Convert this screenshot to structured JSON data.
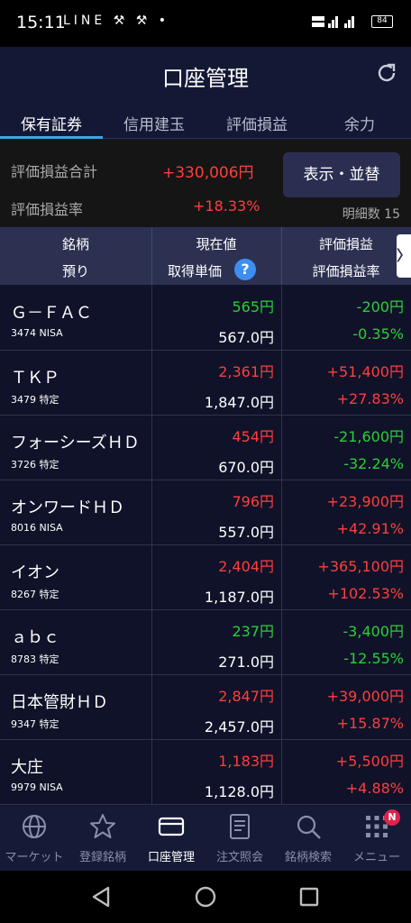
{
  "status_bar": {
    "time": "15:11",
    "left_icons": "LINE ⚒ ⚒ •",
    "battery": "84"
  },
  "header": {
    "title": "口座管理"
  },
  "tabs": [
    {
      "label": "保有証券"
    },
    {
      "label": "信用建玉"
    },
    {
      "label": "評価損益"
    },
    {
      "label": "余力"
    }
  ],
  "summary": {
    "total_label": "評価損益合計",
    "total_value": "+330,006円",
    "rate_label": "評価損益率",
    "rate_value": "+18.33%",
    "display_button": "表示・並替",
    "count": "明細数 15"
  },
  "table_header": {
    "col1_line1": "銘柄",
    "col1_line2": "預り",
    "col2_line1": "現在値",
    "col2_line2": "取得単価",
    "col3_line1": "評価損益",
    "col3_line2": "評価損益率",
    "help_icon": "?",
    "scroll_icon": "〉"
  },
  "holdings": [
    {
      "name": "Ｇ－ＦＡＣ",
      "code": "3474 NISA",
      "price": "565円",
      "cost": "567.0円",
      "pl": "-200円",
      "rate": "-0.35%",
      "dir": "down",
      "price_dir": "down"
    },
    {
      "name": "ＴＫＰ",
      "code": "3479 特定",
      "price": "2,361円",
      "cost": "1,847.0円",
      "pl": "+51,400円",
      "rate": "+27.83%",
      "dir": "up",
      "price_dir": "up"
    },
    {
      "name": "フォーシーズＨＤ",
      "code": "3726 特定",
      "price": "454円",
      "cost": "670.0円",
      "pl": "-21,600円",
      "rate": "-32.24%",
      "dir": "down",
      "price_dir": "up"
    },
    {
      "name": "オンワードＨＤ",
      "code": "8016 NISA",
      "price": "796円",
      "cost": "557.0円",
      "pl": "+23,900円",
      "rate": "+42.91%",
      "dir": "up",
      "price_dir": "up"
    },
    {
      "name": "イオン",
      "code": "8267 特定",
      "price": "2,404円",
      "cost": "1,187.0円",
      "pl": "+365,100円",
      "rate": "+102.53%",
      "dir": "up",
      "price_dir": "up"
    },
    {
      "name": "ａｂｃ",
      "code": "8783 特定",
      "price": "237円",
      "cost": "271.0円",
      "pl": "-3,400円",
      "rate": "-12.55%",
      "dir": "down",
      "price_dir": "down"
    },
    {
      "name": "日本管財ＨＤ",
      "code": "9347 特定",
      "price": "2,847円",
      "cost": "2,457.0円",
      "pl": "+39,000円",
      "rate": "+15.87%",
      "dir": "up",
      "price_dir": "up"
    },
    {
      "name": "大庄",
      "code": "9979 NISA",
      "price": "1,183円",
      "cost": "1,128.0円",
      "pl": "+5,500円",
      "rate": "+4.88%",
      "dir": "up",
      "price_dir": "up"
    }
  ],
  "bottom_nav": [
    {
      "label": "マーケット",
      "icon": "globe-icon"
    },
    {
      "label": "登録銘柄",
      "icon": "star-icon"
    },
    {
      "label": "口座管理",
      "icon": "card-icon"
    },
    {
      "label": "注文照会",
      "icon": "document-icon"
    },
    {
      "label": "銘柄検索",
      "icon": "search-icon"
    },
    {
      "label": "メニュー",
      "icon": "grid-menu-icon",
      "badge": "N"
    }
  ],
  "colors": {
    "up": "#ff3e3e",
    "down": "#2ccf3a",
    "accent": "#3da5e6",
    "header_bg": "#131835"
  }
}
